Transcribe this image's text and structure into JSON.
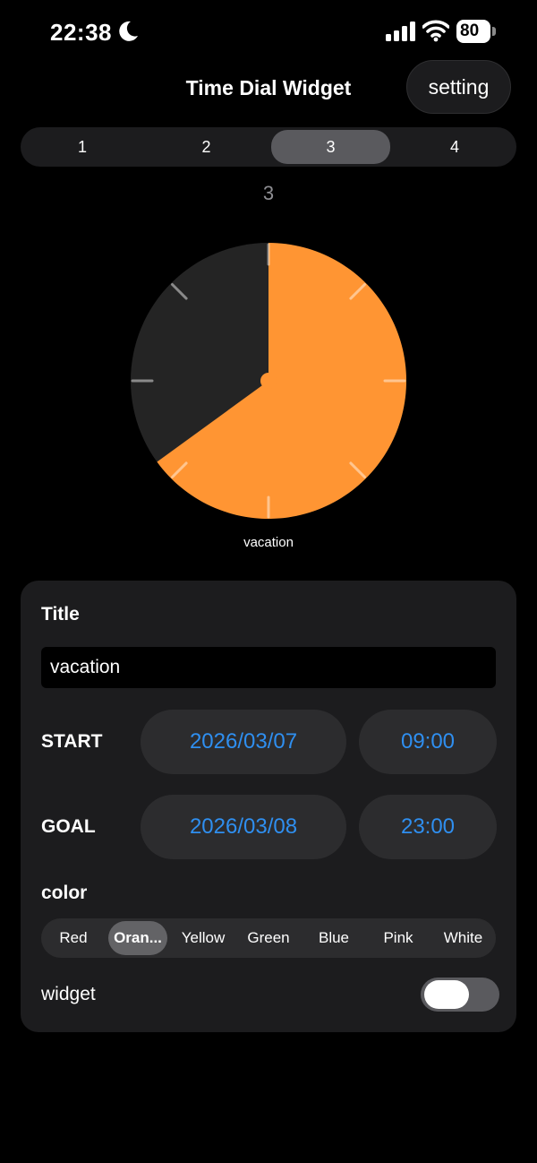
{
  "status": {
    "time": "22:38",
    "battery": "80",
    "icons": [
      "moon-icon",
      "signal-icon",
      "wifi-icon",
      "battery-icon"
    ]
  },
  "nav": {
    "title": "Time Dial Widget",
    "setting_label": "setting"
  },
  "tabs": {
    "items": [
      "1",
      "2",
      "3",
      "4"
    ],
    "selected": 2
  },
  "page_index": "3",
  "dial": {
    "label": "vacation",
    "fill_fraction": 0.65,
    "fill_color": "#ff9533",
    "track_color": "#242424"
  },
  "form": {
    "title_label": "Title",
    "title_value": "vacation",
    "start_label": "START",
    "start_date": "2026/03/07",
    "start_time": "09:00",
    "goal_label": "GOAL",
    "goal_date": "2026/03/08",
    "goal_time": "23:00",
    "color_label": "color",
    "colors": [
      "Red",
      "Oran...",
      "Yellow",
      "Green",
      "Blue",
      "Pink",
      "White"
    ],
    "selected_color": 1,
    "widget_label": "widget",
    "widget_on": false
  },
  "theme": {
    "accent": "#2f8ff0",
    "background": "#000000",
    "card": "#1c1c1e"
  }
}
